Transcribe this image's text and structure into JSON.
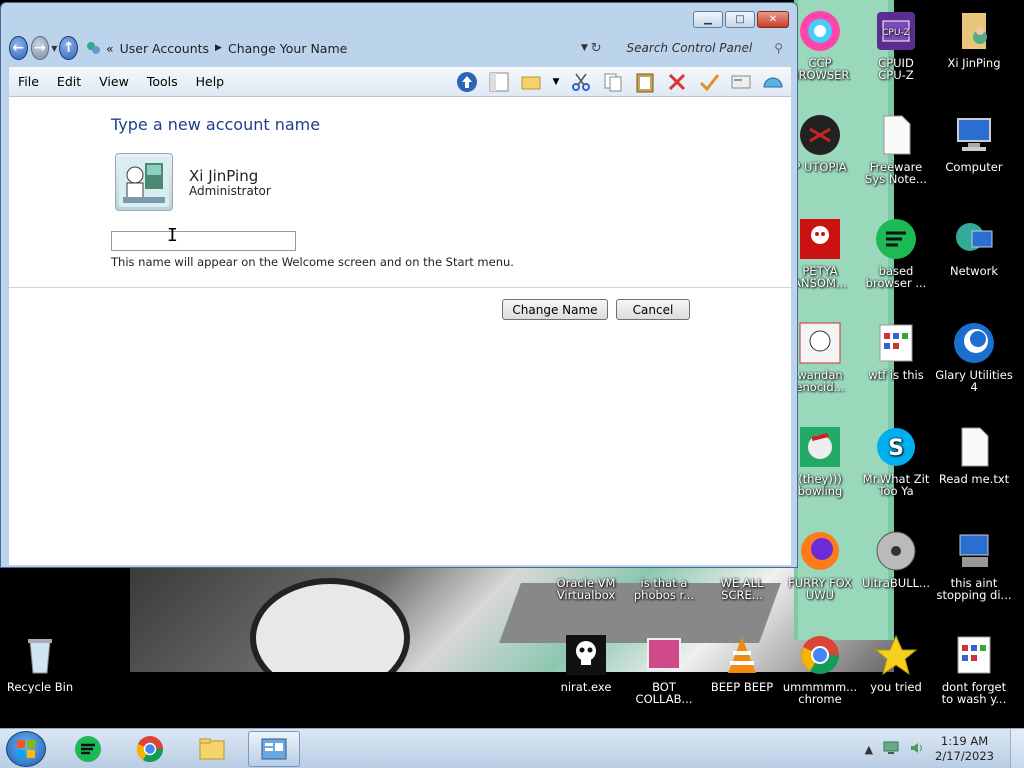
{
  "window": {
    "breadcrumb": [
      "User Accounts",
      "Change Your Name"
    ],
    "breadcrumb_prefix": "«",
    "search_placeholder": "Search Control Panel",
    "menu": [
      "File",
      "Edit",
      "View",
      "Tools",
      "Help"
    ]
  },
  "content": {
    "heading": "Type a new account name",
    "user_name": "Xi JinPing",
    "user_role": "Administrator",
    "input_value": "",
    "hint": "This name will appear on the Welcome screen and on the Start menu.",
    "change_button": "Change Name",
    "cancel_button": "Cancel"
  },
  "desktop": {
    "icons": [
      {
        "label": "CCP\nBROWSER",
        "icon": "browser-icon"
      },
      {
        "label": "CPUID\nCPU-Z",
        "icon": "cpuz-icon"
      },
      {
        "label": "Xi JinPing",
        "icon": "user-folder-icon"
      },
      {
        "label": "P UTOPIA",
        "icon": "utopia-icon"
      },
      {
        "label": "Freeware\nSys Note...",
        "icon": "document-icon"
      },
      {
        "label": "Computer",
        "icon": "computer-icon"
      },
      {
        "label": "PETYA\nANSOM...",
        "icon": "skull-icon"
      },
      {
        "label": "based\nbrowser ...",
        "icon": "browser-icon"
      },
      {
        "label": "Network",
        "icon": "network-icon"
      },
      {
        "label": "wandan\nenocid...",
        "icon": "image-icon"
      },
      {
        "label": "wtf is this",
        "icon": "app-window-icon"
      },
      {
        "label": "Glary Utilities\n4",
        "icon": "glary-icon"
      },
      {
        "label": "(they)))\nbowling",
        "icon": "image-icon"
      },
      {
        "label": "Mr.What Zit\nToo Ya",
        "icon": "skype-icon"
      },
      {
        "label": "Read me.txt",
        "icon": "text-file-icon"
      },
      {
        "label": "Oracle VM\nVirtualbox",
        "icon": "virtualbox-icon"
      },
      {
        "label": "is that a\nphobos r...",
        "icon": "file-icon"
      },
      {
        "label": "WE ALL\nSCRE...",
        "icon": "file-icon"
      },
      {
        "label": "FURRY FOX\nUWU",
        "icon": "firefox-icon"
      },
      {
        "label": "UltraBULL...",
        "icon": "disc-icon"
      },
      {
        "label": "this aint\nstopping di...",
        "icon": "installer-icon"
      },
      {
        "label": "Recycle Bin",
        "icon": "recycle-bin-icon"
      },
      {
        "label": "nirat.exe",
        "icon": "skull-icon"
      },
      {
        "label": "BOT\nCOLLAB...",
        "icon": "app-icon"
      },
      {
        "label": "BEEP BEEP",
        "icon": "vlc-icon"
      },
      {
        "label": "ummmmm...\nchrome",
        "icon": "chrome-icon"
      },
      {
        "label": "you tried",
        "icon": "star-icon"
      },
      {
        "label": "dont forget\nto wash y...",
        "icon": "app-window-icon"
      }
    ]
  },
  "taskbar": {
    "time": "1:19 AM",
    "date": "2/17/2023"
  }
}
